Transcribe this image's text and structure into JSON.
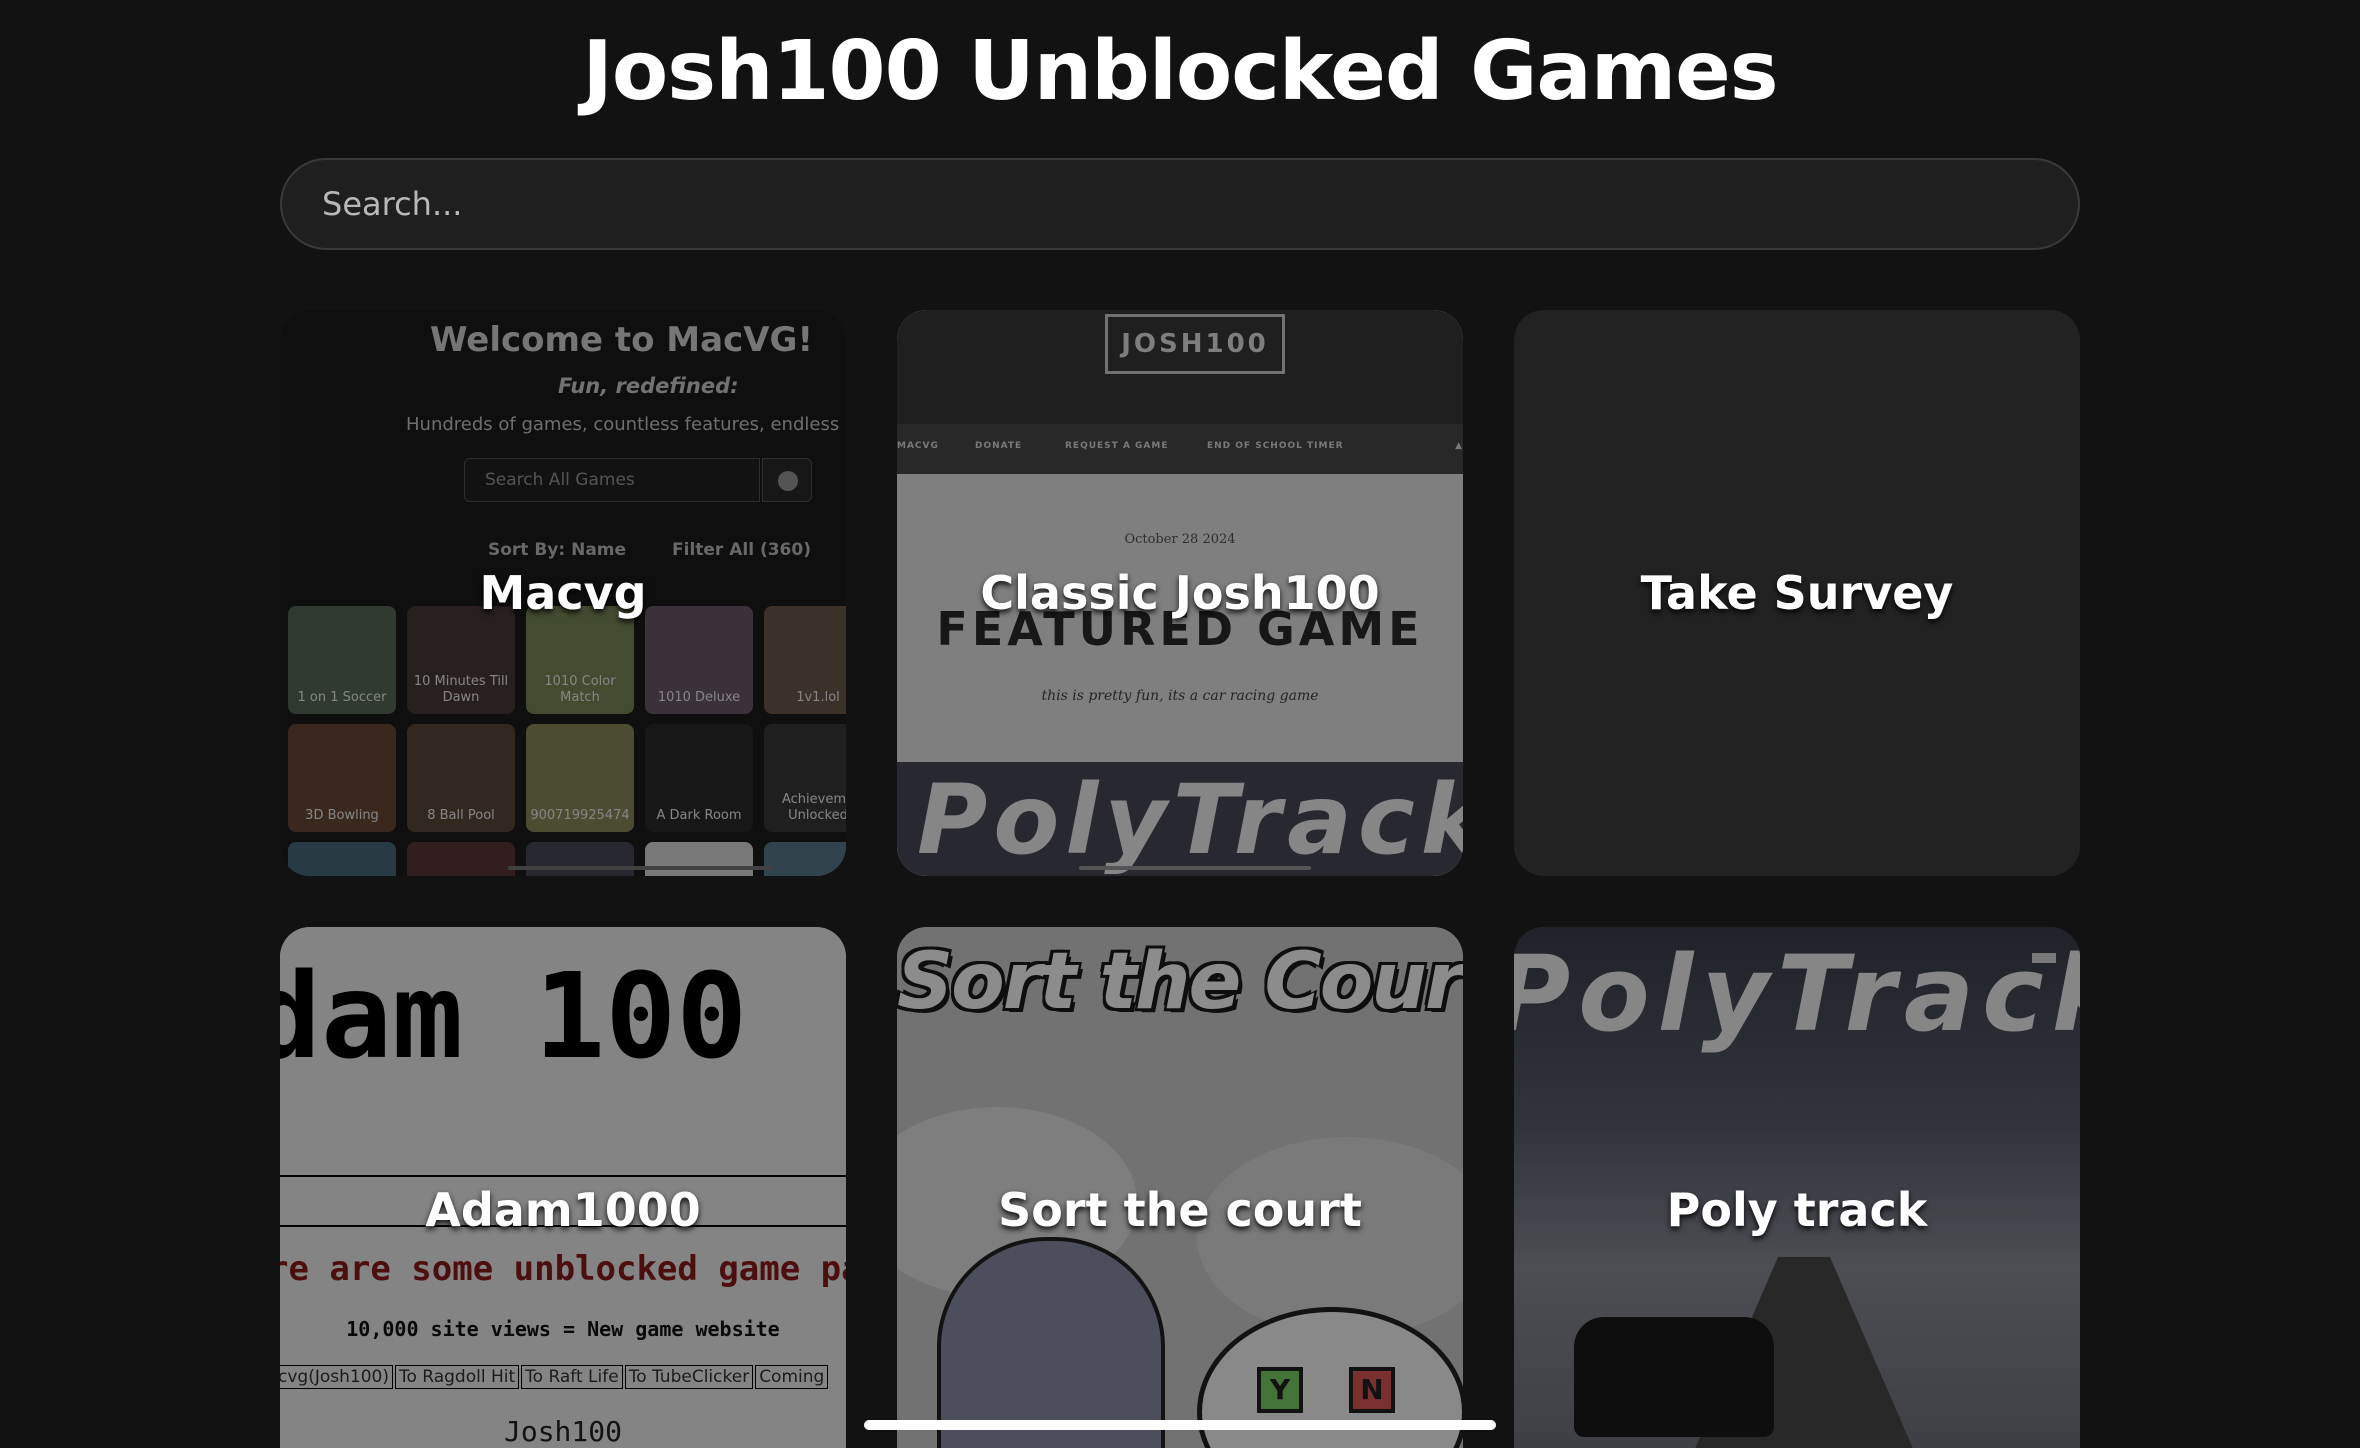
{
  "header": {
    "title": "Josh100 Unblocked Games"
  },
  "search": {
    "placeholder": "Search..."
  },
  "cards": [
    {
      "title": "Macvg",
      "preview": {
        "heading": "Welcome to MacVG!",
        "tagline": "Fun, redefined:",
        "description": "Hundreds of games, countless features, endless pl",
        "search_placeholder": "Search All Games",
        "sort": "Sort By: Name",
        "filter": "Filter All (360)",
        "tiles": [
          "1 on 1 Soccer",
          "10 Minutes Till Dawn",
          "1010 Color Match",
          "1010 Deluxe",
          "1v1.lol",
          "3D Bowling",
          "8 Ball Pool",
          "900719925474",
          "A Dark Room",
          "Achieveme Unlocked"
        ]
      }
    },
    {
      "title": "Classic Josh100",
      "preview": {
        "logo": "JOSH100",
        "nav": [
          "MACVG",
          "DONATE",
          "REQUEST A GAME",
          "END OF SCHOOL TIMER"
        ],
        "date": "October 28 2024",
        "featured": "FEATURED GAME",
        "note": "this is pretty fun, its a car racing game",
        "banner": "PolyTrack"
      }
    },
    {
      "title": "Take Survey"
    },
    {
      "title": "Adam1000",
      "preview": {
        "big": "dam 100",
        "banner": "re are some unblocked game pag",
        "views": "10,000 site views = New game website",
        "links": [
          "cvg(Josh100)",
          "To Ragdoll Hit",
          "To Raft Life",
          "To TubeClicker",
          "Coming"
        ],
        "footer": "Josh100"
      }
    },
    {
      "title": "Sort the court",
      "preview": {
        "logo": "Sort the Court!",
        "yes": "Y",
        "no": "N"
      }
    },
    {
      "title": "Poly track",
      "preview": {
        "logo": "PolyTrack"
      }
    }
  ]
}
